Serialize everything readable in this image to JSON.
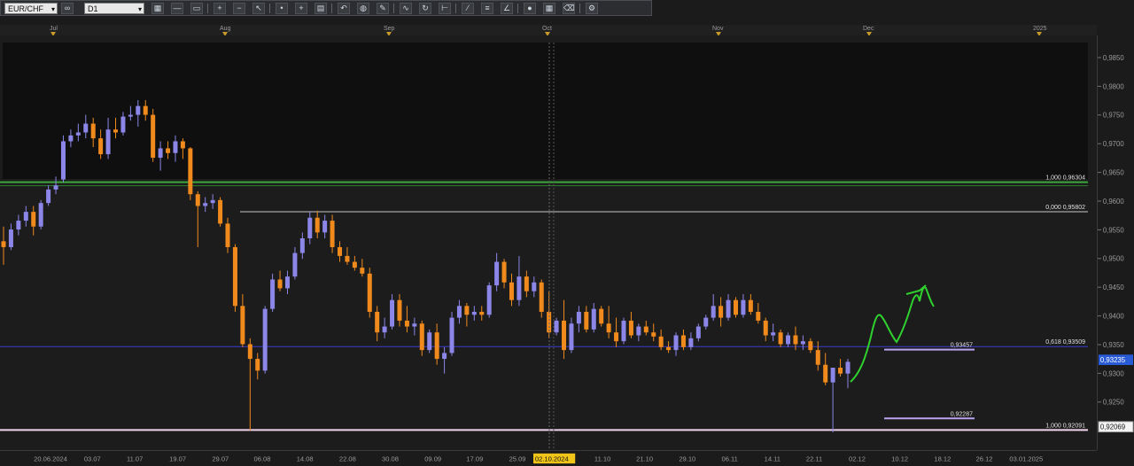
{
  "toolbar": {
    "symbol": "EUR/CHF",
    "timeframe": "D1",
    "icons": [
      "chart-type-icon",
      "line-icon",
      "rectangle-icon",
      "zoom-in-icon",
      "zoom-out-icon",
      "cursor-icon",
      "dot-icon",
      "crosshair-icon",
      "template-icon",
      "undo-icon",
      "globe-icon",
      "pencil-icon",
      "indicators-icon",
      "refresh-icon",
      "ruler-icon",
      "trend-icon",
      "channel-icon",
      "gann-icon",
      "circle-icon",
      "grid-icon",
      "eraser-icon",
      "settings-icon"
    ]
  },
  "time_axis": {
    "months": [
      "Jul",
      "Aug",
      "Sep",
      "Oct",
      "Nov",
      "Dec",
      "2025"
    ]
  },
  "chart_data": {
    "type": "candlestick",
    "symbol": "EUR/CHF",
    "timeframe": "D1",
    "ylim": [
      0.919,
      0.988
    ],
    "price_ticks": [
      "0,9850",
      "0,9800",
      "0,9750",
      "0,9700",
      "0,9650",
      "0,9600",
      "0,9550",
      "0,9500",
      "0,9450",
      "0,9400",
      "0,9350",
      "0,9300",
      "0,9250"
    ],
    "date_ticks": [
      "20.06.2024",
      "03.07",
      "11.07",
      "19.07",
      "29.07",
      "06.08",
      "14.08",
      "22.08",
      "30.08",
      "09.09",
      "17.09",
      "25.09",
      "02.10.2024",
      "11.10",
      "21.10",
      "29.10",
      "06.11",
      "14.11",
      "22.11",
      "02.12",
      "10.12",
      "18.12",
      "26.12",
      "03.01.2025"
    ],
    "highlighted_date": "02.10.2024",
    "current_price": "0,93235",
    "current_price_value": 0.93235,
    "axis_price_marker": "0,92069",
    "axis_price_marker_value": 0.92069,
    "levels": [
      {
        "label": "1,000 0,96304",
        "value": 0.96304,
        "color": "#3aa83a"
      },
      {
        "label": "0,000 0,95802",
        "value": 0.95802,
        "color": "#c8c8c8"
      },
      {
        "label": "0,618 0,93509",
        "value": 0.93509,
        "color": "#3a3ad0"
      },
      {
        "label": "1,000 0,92091",
        "value": 0.92091,
        "color": "#f2d4ee"
      }
    ],
    "target_lines": [
      {
        "label": "0,93457",
        "value": 0.93457,
        "color": "#b9a2f0"
      },
      {
        "label": "0,92287",
        "value": 0.92287,
        "color": "#b9a2f0"
      }
    ],
    "candles": [
      [
        0.953,
        0.9555,
        0.949,
        0.952
      ],
      [
        0.952,
        0.956,
        0.9515,
        0.955
      ],
      [
        0.955,
        0.9575,
        0.954,
        0.9565
      ],
      [
        0.9565,
        0.959,
        0.9555,
        0.958
      ],
      [
        0.958,
        0.959,
        0.954,
        0.9555
      ],
      [
        0.9555,
        0.96,
        0.955,
        0.9595
      ],
      [
        0.9595,
        0.9625,
        0.959,
        0.9618
      ],
      [
        0.9618,
        0.964,
        0.961,
        0.9625
      ],
      [
        0.9635,
        0.971,
        0.963,
        0.97
      ],
      [
        0.97,
        0.972,
        0.969,
        0.971
      ],
      [
        0.971,
        0.973,
        0.97,
        0.9715
      ],
      [
        0.9715,
        0.9745,
        0.9705,
        0.973
      ],
      [
        0.973,
        0.974,
        0.969,
        0.9705
      ],
      [
        0.9705,
        0.972,
        0.967,
        0.9678
      ],
      [
        0.9678,
        0.974,
        0.967,
        0.972
      ],
      [
        0.972,
        0.974,
        0.9705,
        0.9715
      ],
      [
        0.9715,
        0.975,
        0.971,
        0.9742
      ],
      [
        0.9742,
        0.976,
        0.9735,
        0.9745
      ],
      [
        0.9745,
        0.977,
        0.9725,
        0.976
      ],
      [
        0.976,
        0.977,
        0.9735,
        0.9745
      ],
      [
        0.9745,
        0.9755,
        0.9665,
        0.9672
      ],
      [
        0.9672,
        0.97,
        0.965,
        0.9688
      ],
      [
        0.9688,
        0.97,
        0.967,
        0.968
      ],
      [
        0.968,
        0.971,
        0.9665,
        0.97
      ],
      [
        0.97,
        0.9705,
        0.967,
        0.9688
      ],
      [
        0.9688,
        0.969,
        0.96,
        0.961
      ],
      [
        0.961,
        0.9615,
        0.952,
        0.959
      ],
      [
        0.959,
        0.9605,
        0.958,
        0.9595
      ],
      [
        0.9595,
        0.961,
        0.9585,
        0.96
      ],
      [
        0.96,
        0.9605,
        0.9555,
        0.956
      ],
      [
        0.956,
        0.957,
        0.951,
        0.952
      ],
      [
        0.952,
        0.9525,
        0.941,
        0.942
      ],
      [
        0.942,
        0.944,
        0.935,
        0.9355
      ],
      [
        0.9355,
        0.9365,
        0.9208,
        0.933
      ],
      [
        0.933,
        0.934,
        0.9295,
        0.931
      ],
      [
        0.931,
        0.942,
        0.9305,
        0.9415
      ],
      [
        0.9415,
        0.9475,
        0.941,
        0.9465
      ],
      [
        0.9465,
        0.948,
        0.9445,
        0.945
      ],
      [
        0.945,
        0.948,
        0.944,
        0.947
      ],
      [
        0.947,
        0.952,
        0.9465,
        0.951
      ],
      [
        0.951,
        0.9545,
        0.95,
        0.9535
      ],
      [
        0.9535,
        0.958,
        0.9525,
        0.957
      ],
      [
        0.957,
        0.9582,
        0.9535,
        0.9545
      ],
      [
        0.9545,
        0.9575,
        0.9535,
        0.9565
      ],
      [
        0.9565,
        0.9575,
        0.951,
        0.952
      ],
      [
        0.952,
        0.953,
        0.9495,
        0.9505
      ],
      [
        0.9505,
        0.952,
        0.949,
        0.9495
      ],
      [
        0.9495,
        0.9505,
        0.948,
        0.9485
      ],
      [
        0.9485,
        0.95,
        0.947,
        0.9475
      ],
      [
        0.9475,
        0.9485,
        0.94,
        0.941
      ],
      [
        0.941,
        0.942,
        0.936,
        0.9375
      ],
      [
        0.9375,
        0.94,
        0.9365,
        0.9385
      ],
      [
        0.9385,
        0.944,
        0.938,
        0.943
      ],
      [
        0.943,
        0.944,
        0.9385,
        0.9395
      ],
      [
        0.9395,
        0.942,
        0.9375,
        0.9385
      ],
      [
        0.9385,
        0.94,
        0.937,
        0.939
      ],
      [
        0.939,
        0.9395,
        0.9335,
        0.9345
      ],
      [
        0.9345,
        0.938,
        0.934,
        0.9375
      ],
      [
        0.9375,
        0.939,
        0.932,
        0.933
      ],
      [
        0.933,
        0.935,
        0.9305,
        0.934
      ],
      [
        0.934,
        0.941,
        0.9335,
        0.94
      ],
      [
        0.94,
        0.943,
        0.939,
        0.942
      ],
      [
        0.942,
        0.9425,
        0.9385,
        0.9405
      ],
      [
        0.9405,
        0.942,
        0.9395,
        0.941
      ],
      [
        0.941,
        0.942,
        0.9395,
        0.9405
      ],
      [
        0.9405,
        0.946,
        0.94,
        0.9455
      ],
      [
        0.9455,
        0.951,
        0.9445,
        0.9495
      ],
      [
        0.9495,
        0.95,
        0.945,
        0.946
      ],
      [
        0.946,
        0.9475,
        0.942,
        0.943
      ],
      [
        0.943,
        0.9505,
        0.942,
        0.947
      ],
      [
        0.947,
        0.948,
        0.9435,
        0.9445
      ],
      [
        0.9445,
        0.947,
        0.9435,
        0.946
      ],
      [
        0.946,
        0.9465,
        0.94,
        0.941
      ],
      [
        0.941,
        0.9445,
        0.9365,
        0.9375
      ],
      [
        0.9375,
        0.94,
        0.937,
        0.9395
      ],
      [
        0.9395,
        0.943,
        0.933,
        0.9345
      ],
      [
        0.9345,
        0.94,
        0.934,
        0.939
      ],
      [
        0.939,
        0.942,
        0.9375,
        0.941
      ],
      [
        0.941,
        0.942,
        0.9375,
        0.938
      ],
      [
        0.938,
        0.9425,
        0.9375,
        0.9415
      ],
      [
        0.9415,
        0.942,
        0.9385,
        0.939
      ],
      [
        0.939,
        0.942,
        0.9365,
        0.9375
      ],
      [
        0.9375,
        0.94,
        0.935,
        0.936
      ],
      [
        0.936,
        0.94,
        0.9355,
        0.9395
      ],
      [
        0.9395,
        0.941,
        0.9365,
        0.937
      ],
      [
        0.937,
        0.939,
        0.936,
        0.9385
      ],
      [
        0.9385,
        0.9395,
        0.937,
        0.9375
      ],
      [
        0.9375,
        0.939,
        0.936,
        0.9368
      ],
      [
        0.9368,
        0.938,
        0.9345,
        0.935
      ],
      [
        0.935,
        0.936,
        0.934,
        0.9345
      ],
      [
        0.9345,
        0.9375,
        0.9335,
        0.937
      ],
      [
        0.937,
        0.938,
        0.9345,
        0.935
      ],
      [
        0.935,
        0.9375,
        0.9345,
        0.9365
      ],
      [
        0.9365,
        0.939,
        0.936,
        0.9385
      ],
      [
        0.9385,
        0.9405,
        0.938,
        0.94
      ],
      [
        0.94,
        0.944,
        0.9395,
        0.942
      ],
      [
        0.942,
        0.9435,
        0.9385,
        0.94
      ],
      [
        0.94,
        0.944,
        0.9395,
        0.943
      ],
      [
        0.943,
        0.9435,
        0.94,
        0.9405
      ],
      [
        0.9405,
        0.944,
        0.94,
        0.943
      ],
      [
        0.943,
        0.944,
        0.9405,
        0.941
      ],
      [
        0.941,
        0.9425,
        0.939,
        0.9395
      ],
      [
        0.9395,
        0.94,
        0.936,
        0.937
      ],
      [
        0.937,
        0.939,
        0.936,
        0.9375
      ],
      [
        0.9375,
        0.938,
        0.935,
        0.9355
      ],
      [
        0.9355,
        0.9375,
        0.935,
        0.937
      ],
      [
        0.937,
        0.9385,
        0.9345,
        0.9355
      ],
      [
        0.9355,
        0.937,
        0.9345,
        0.936
      ],
      [
        0.936,
        0.9365,
        0.934,
        0.9345
      ],
      [
        0.9345,
        0.936,
        0.931,
        0.932
      ],
      [
        0.932,
        0.934,
        0.9285,
        0.929
      ],
      [
        0.929,
        0.9305,
        0.9205,
        0.9315
      ],
      [
        0.9315,
        0.933,
        0.93,
        0.9305
      ],
      [
        0.9305,
        0.933,
        0.928,
        0.9325
      ]
    ]
  }
}
